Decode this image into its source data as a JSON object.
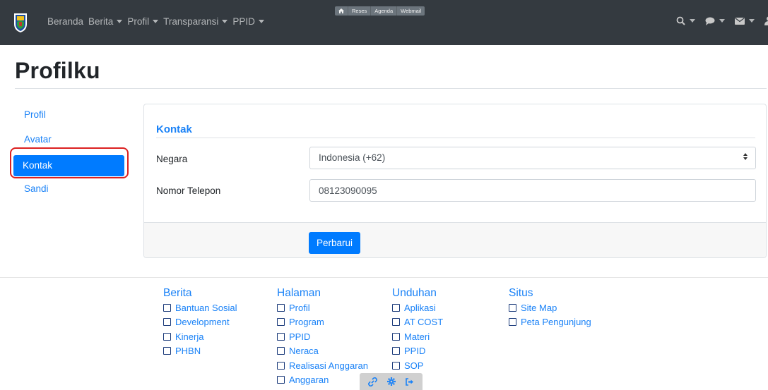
{
  "navbar": {
    "links": [
      {
        "label": "Beranda",
        "dropdown": false
      },
      {
        "label": "Berita",
        "dropdown": true
      },
      {
        "label": "Profil",
        "dropdown": true
      },
      {
        "label": "Transparansi",
        "dropdown": true
      },
      {
        "label": "PPID",
        "dropdown": true
      }
    ],
    "mini_links": [
      "Reses",
      "Agenda",
      "Webmail"
    ],
    "right_icons": [
      "search-icon",
      "comment-icon",
      "envelope-icon",
      "user-icon"
    ],
    "logo_icon": "east-java-emblem"
  },
  "page": {
    "title": "Profilku"
  },
  "sidebar": {
    "items": [
      {
        "label": "Profil",
        "active": false
      },
      {
        "label": "Avatar",
        "active": false
      },
      {
        "label": "Kontak",
        "active": true
      },
      {
        "label": "Sandi",
        "active": false
      }
    ]
  },
  "form": {
    "section_title": "Kontak",
    "country_label": "Negara",
    "country_value": "Indonesia (+62)",
    "phone_label": "Nomor Telepon",
    "phone_value": "08123090095",
    "submit_label": "Perbarui"
  },
  "footer": {
    "columns": [
      {
        "heading": "Berita",
        "links": [
          "Bantuan Sosial",
          "Development",
          "Kinerja",
          "PHBN"
        ]
      },
      {
        "heading": "Halaman",
        "links": [
          "Profil",
          "Program",
          "PPID",
          "Neraca",
          "Realisasi Anggaran",
          "Anggaran"
        ]
      },
      {
        "heading": "Unduhan",
        "links": [
          "Aplikasi",
          "AT COST",
          "Materi",
          "PPID",
          "SOP"
        ]
      },
      {
        "heading": "Situs",
        "links": [
          "Site Map",
          "Peta Pengunjung"
        ]
      }
    ]
  },
  "floating_toolbar": {
    "icons": [
      "link-icon",
      "gear-icon",
      "sign-out-icon"
    ]
  },
  "colors": {
    "navbar_bg": "#343a40",
    "accent": "#007bff",
    "link": "#1a82f7",
    "highlight_outline": "#dc2020"
  }
}
